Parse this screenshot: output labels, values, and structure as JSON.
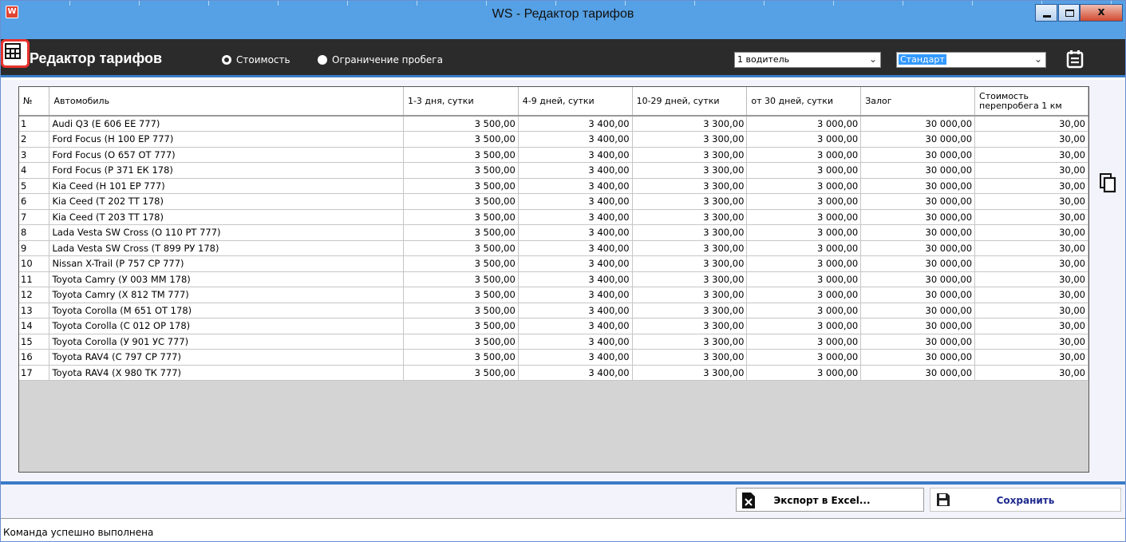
{
  "window": {
    "icon_letter": "W",
    "title": "WS - Редактор тарифов",
    "close_glyph": "x"
  },
  "header": {
    "title": "Редактор тарифов",
    "radio_cost": "Стоимость",
    "radio_mileage": "Ограничение пробега",
    "selected_radio": "cost",
    "drivers_select": "1 водитель",
    "plan_select": "Стандарт"
  },
  "table": {
    "columns": [
      "№",
      "Автомобиль",
      "1-3 дня, сутки",
      "4-9 дней, сутки",
      "10-29 дней, сутки",
      "от 30 дней, сутки",
      "Залог",
      "Стоимость перепробега 1 км"
    ],
    "rows": [
      [
        "1",
        "Audi Q3 (Е 606 ЕЕ 777)",
        "3 500,00",
        "3 400,00",
        "3 300,00",
        "3 000,00",
        "30 000,00",
        "30,00"
      ],
      [
        "2",
        "Ford Focus (Н 100 ЕР 777)",
        "3 500,00",
        "3 400,00",
        "3 300,00",
        "3 000,00",
        "30 000,00",
        "30,00"
      ],
      [
        "3",
        "Ford Focus (О 657 ОТ 777)",
        "3 500,00",
        "3 400,00",
        "3 300,00",
        "3 000,00",
        "30 000,00",
        "30,00"
      ],
      [
        "4",
        "Ford Focus (Р 371 ЕК 178)",
        "3 500,00",
        "3 400,00",
        "3 300,00",
        "3 000,00",
        "30 000,00",
        "30,00"
      ],
      [
        "5",
        "Kia Ceed (Н 101 ЕР 777)",
        "3 500,00",
        "3 400,00",
        "3 300,00",
        "3 000,00",
        "30 000,00",
        "30,00"
      ],
      [
        "6",
        "Kia Ceed (Т 202 ТТ 178)",
        "3 500,00",
        "3 400,00",
        "3 300,00",
        "3 000,00",
        "30 000,00",
        "30,00"
      ],
      [
        "7",
        "Kia Ceed (Т 203 ТТ 178)",
        "3 500,00",
        "3 400,00",
        "3 300,00",
        "3 000,00",
        "30 000,00",
        "30,00"
      ],
      [
        "8",
        "Lada Vesta SW Cross (О 110 РТ 777)",
        "3 500,00",
        "3 400,00",
        "3 300,00",
        "3 000,00",
        "30 000,00",
        "30,00"
      ],
      [
        "9",
        "Lada Vesta SW Cross (Т 899 РУ 178)",
        "3 500,00",
        "3 400,00",
        "3 300,00",
        "3 000,00",
        "30 000,00",
        "30,00"
      ],
      [
        "10",
        "Nissan X-Trail (Р 757 СР 777)",
        "3 500,00",
        "3 400,00",
        "3 300,00",
        "3 000,00",
        "30 000,00",
        "30,00"
      ],
      [
        "11",
        "Toyota Camry (У 003 ММ 178)",
        "3 500,00",
        "3 400,00",
        "3 300,00",
        "3 000,00",
        "30 000,00",
        "30,00"
      ],
      [
        "12",
        "Toyota Camry (Х 812 ТМ 777)",
        "3 500,00",
        "3 400,00",
        "3 300,00",
        "3 000,00",
        "30 000,00",
        "30,00"
      ],
      [
        "13",
        "Toyota Corolla (М 651 ОТ 178)",
        "3 500,00",
        "3 400,00",
        "3 300,00",
        "3 000,00",
        "30 000,00",
        "30,00"
      ],
      [
        "14",
        "Toyota Corolla (С 012 ОР 178)",
        "3 500,00",
        "3 400,00",
        "3 300,00",
        "3 000,00",
        "30 000,00",
        "30,00"
      ],
      [
        "15",
        "Toyota Corolla (У 901 УС 777)",
        "3 500,00",
        "3 400,00",
        "3 300,00",
        "3 000,00",
        "30 000,00",
        "30,00"
      ],
      [
        "16",
        "Toyota RAV4 (С 797 СР 777)",
        "3 500,00",
        "3 400,00",
        "3 300,00",
        "3 000,00",
        "30 000,00",
        "30,00"
      ],
      [
        "17",
        "Toyota RAV4 (Х 980 ТК 777)",
        "3 500,00",
        "3 400,00",
        "3 300,00",
        "3 000,00",
        "30 000,00",
        "30,00"
      ]
    ]
  },
  "actions": {
    "export_label": "Экспорт в Excel...",
    "save_label": "Сохранить"
  },
  "status": {
    "text": "Команда успешно выполнена"
  },
  "icons": {
    "app": "app-logo-icon",
    "calendar": "calendar-icon",
    "grid": "table-grid-icon",
    "copy": "copy-icon",
    "export": "excel-file-icon",
    "save": "floppy-disk-icon"
  },
  "colors": {
    "titlebar": "#56a1e5",
    "header": "#2b2b2b",
    "accent": "#3a7bc8",
    "highlight_border": "#e8322c",
    "save_text": "#1f2b8f",
    "selection": "#3399ff"
  }
}
